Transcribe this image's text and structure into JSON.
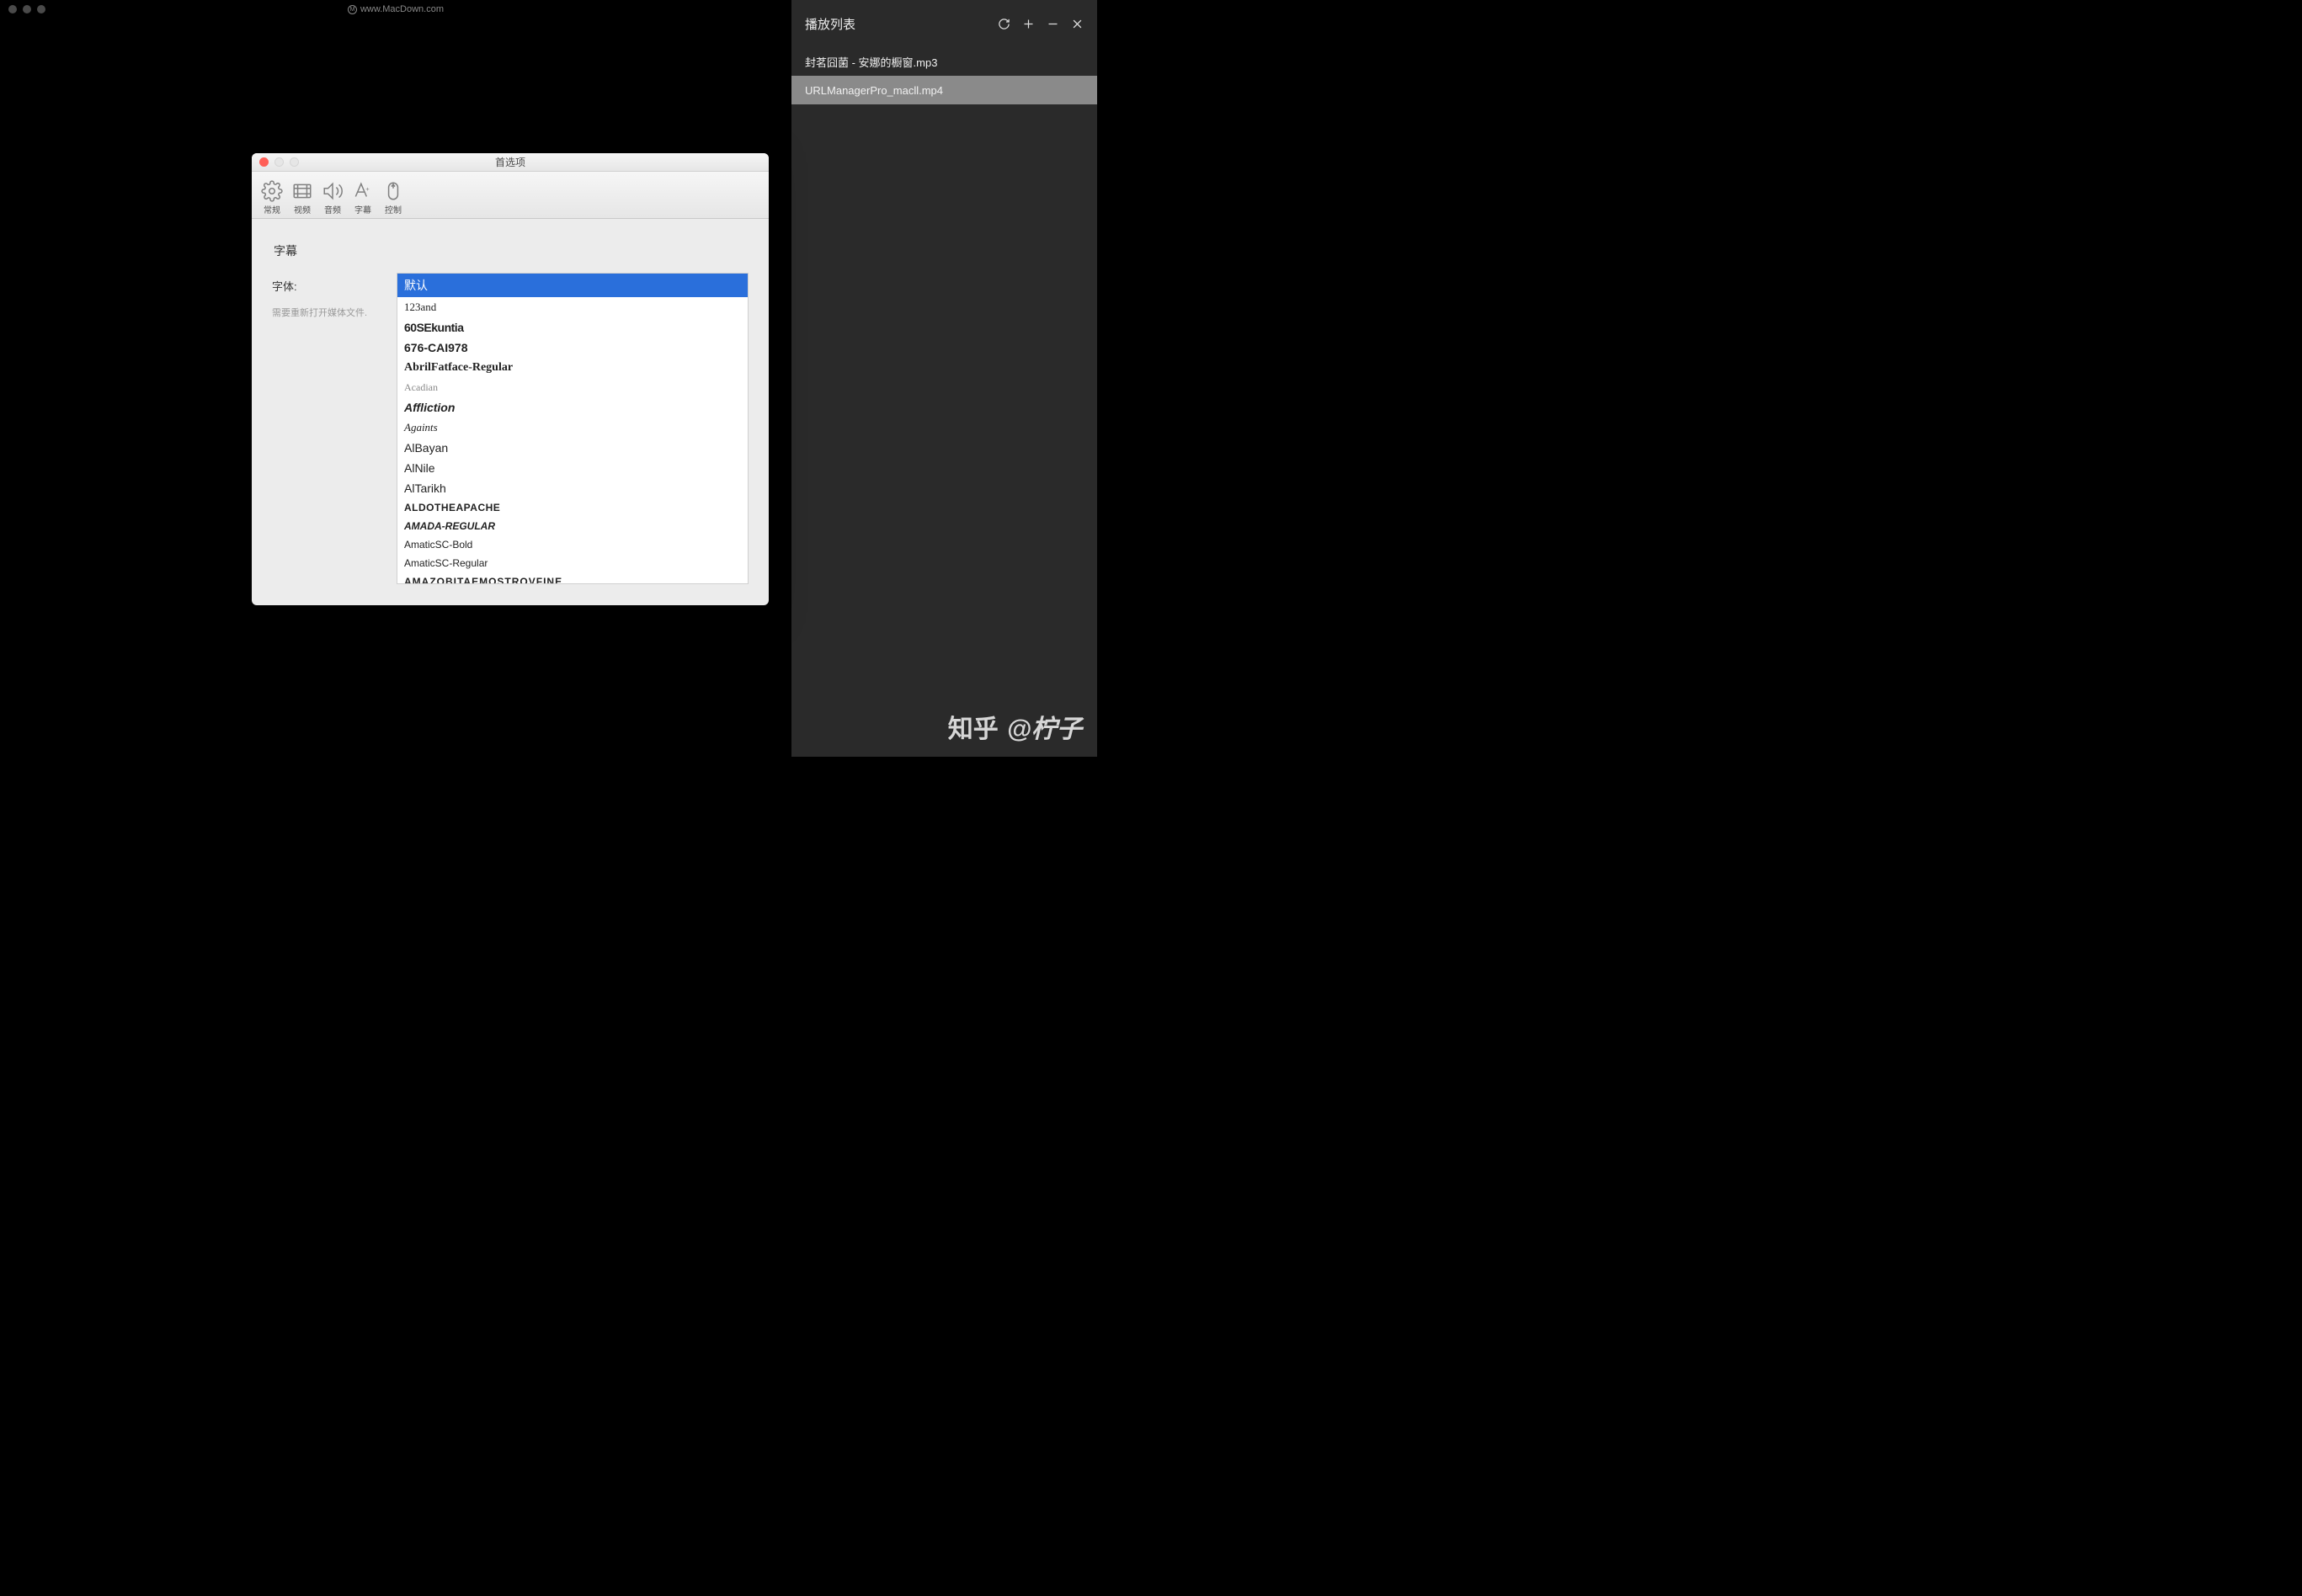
{
  "main_window": {
    "title": "www.MacDown.com"
  },
  "playlist": {
    "title": "播放列表",
    "items": [
      {
        "name": "封茗囧菌 - 安娜的橱窗.mp3",
        "selected": false
      },
      {
        "name": "URLManagerPro_macll.mp4",
        "selected": true
      }
    ]
  },
  "prefs": {
    "title": "首选项",
    "toolbar": [
      {
        "id": "general",
        "label": "常规"
      },
      {
        "id": "video",
        "label": "视频"
      },
      {
        "id": "audio",
        "label": "音频"
      },
      {
        "id": "subtitle",
        "label": "字幕"
      },
      {
        "id": "control",
        "label": "控制"
      }
    ],
    "section_label": "字幕",
    "field_label": "字体:",
    "field_hint": "需要重新打开媒体文件.",
    "fonts": [
      {
        "name": "默认",
        "style": "",
        "selected": true
      },
      {
        "name": "123and",
        "style": "f-script"
      },
      {
        "name": "60SEkuntia",
        "style": "f-heavy"
      },
      {
        "name": "676-CAI978",
        "style": "f-cond"
      },
      {
        "name": "AbrilFatface-Regular",
        "style": "f-serif"
      },
      {
        "name": "Acadian",
        "style": "f-light-serif"
      },
      {
        "name": "Affliction",
        "style": "f-italic-bold"
      },
      {
        "name": "Againts",
        "style": "f-brush"
      },
      {
        "name": "AlBayan",
        "style": ""
      },
      {
        "name": "AlNile",
        "style": ""
      },
      {
        "name": "AlTarikh",
        "style": ""
      },
      {
        "name": "ALDOTHEAPACHE",
        "style": "f-narrow"
      },
      {
        "name": "AMADA-REGULAR",
        "style": "f-italic-cond"
      },
      {
        "name": "AmaticSC-Bold",
        "style": "f-thin"
      },
      {
        "name": "AmaticSC-Regular",
        "style": "f-thin"
      },
      {
        "name": "AMAZOBITAEMOSTROVFINE",
        "style": "f-wide"
      }
    ]
  },
  "watermark": {
    "brand": "知乎",
    "user": "@柠子"
  }
}
